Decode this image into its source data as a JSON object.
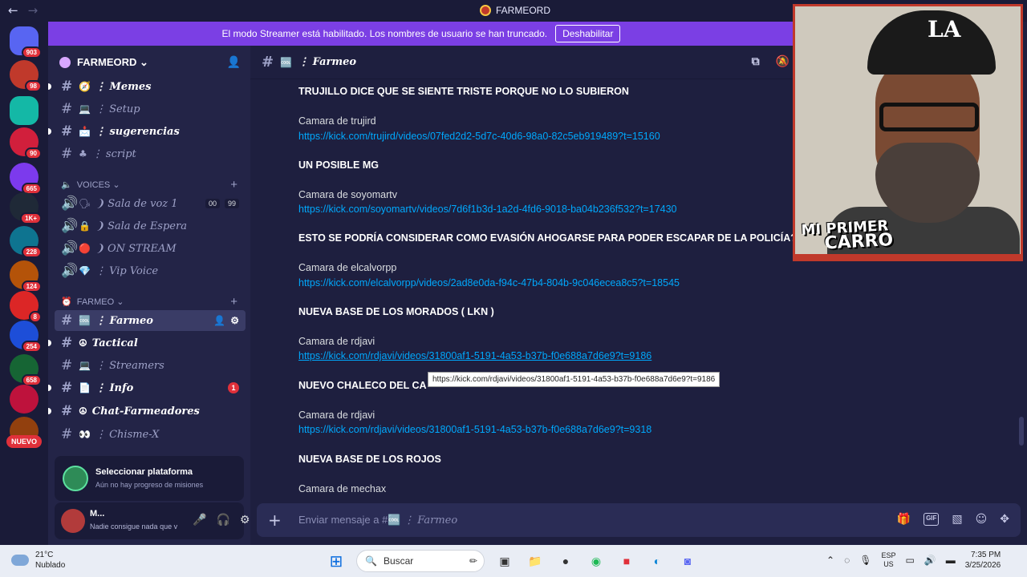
{
  "titlebar": {
    "back_icon": "←",
    "forward_icon": "→",
    "app_title": "FARMEORD"
  },
  "banner": {
    "text": "El modo Streamer está habilitado. Los nombres de usuario se han truncado.",
    "button": "Deshabilitar",
    "color": "#7b3fe4"
  },
  "servers": [
    {
      "name": "home",
      "badge": "903",
      "color": "#5865f2"
    },
    {
      "name": "farmeo-server",
      "badge": "98",
      "color": "#c0392b"
    },
    {
      "name": "folder",
      "badge": "",
      "color": "#14b8a6"
    },
    {
      "name": "server-red",
      "badge": "90",
      "color": "#d11f3c"
    },
    {
      "name": "server-purple",
      "badge": "665",
      "color": "#7c3aed"
    },
    {
      "name": "server-speaker",
      "badge": "1K+",
      "color": "#1f2937"
    },
    {
      "name": "server-girl",
      "badge": "228",
      "color": "#0e7490"
    },
    {
      "name": "server-anime",
      "badge": "124",
      "color": "#b45309"
    },
    {
      "name": "server-mushroom",
      "badge": "8",
      "color": "#dc2626"
    },
    {
      "name": "server-sonic",
      "badge": "254",
      "color": "#1d4ed8"
    },
    {
      "name": "server-green",
      "badge": "658",
      "color": "#166534"
    },
    {
      "name": "server-char",
      "badge": "",
      "color": "#be123c"
    },
    {
      "name": "server-last",
      "badge": "",
      "color": "#92400e"
    }
  ],
  "new_label": "NUEVO",
  "guild": {
    "name": "FARMEORD ⌄"
  },
  "channels": {
    "memes": {
      "emoji": "🧭",
      "label": "⋮ Memes"
    },
    "setup": {
      "emoji": "💻",
      "label": "⋮ Setup"
    },
    "sugerencias": {
      "emoji": "📩",
      "label": "⋮ sugerencias"
    },
    "script": {
      "emoji": "♣",
      "label": "⋮ script"
    },
    "voices_category": "VOICES ⌄",
    "sala_voz": {
      "emoji": "🗣",
      "label": "❩ Sala de voz 1",
      "count1": "00",
      "count2": "99"
    },
    "sala_espera": {
      "emoji": "🔒",
      "label": "❩ Sala de Espera"
    },
    "on_stream": {
      "emoji": "🔴",
      "label": "❩ ON STREAM"
    },
    "vip_voice": {
      "emoji": "💎",
      "label": "⋮ Vip Voice"
    },
    "farmeo_category": "FARMEO ⌄",
    "farmeo": {
      "emoji": "🆒",
      "label": "⋮ Farmeo"
    },
    "tactical": {
      "emoji": "☮",
      "label": "Tactical"
    },
    "streamers": {
      "emoji": "💻",
      "label": "⋮ Streamers"
    },
    "info": {
      "emoji": "📄",
      "label": "⋮ Info",
      "mentions": "1"
    },
    "chat_farmeadores": {
      "emoji": "☮",
      "label": "Chat-Farmeadores"
    },
    "chisme": {
      "emoji": "👀",
      "label": "⋮ Chisme-X"
    }
  },
  "quest": {
    "title": "Seleccionar plataforma",
    "subtitle": "Aún no hay progreso de misiones"
  },
  "user": {
    "name": "M...",
    "status": "Nadie consigue nada que v"
  },
  "chat": {
    "channel_name": "⋮ Farmeo",
    "channel_emoji": "🆒",
    "composer_placeholder_prefix": "Enviar mensaje a #🆒",
    "composer_placeholder_channel": "⋮ Farmeo"
  },
  "messages": [
    {
      "title": "TRUJILLO DICE QUE SE SIENTE TRISTE PORQUE NO LO SUBIERON",
      "camera": "Camara de trujird",
      "link": "https://kick.com/trujird/videos/07fed2d2-5d7c-40d6-98a0-82c5eb919489?t=15160"
    },
    {
      "title": "UN POSIBLE MG",
      "camera": "Camara de soyomartv",
      "link": "https://kick.com/soyomartv/videos/7d6f1b3d-1a2d-4fd6-9018-ba04b236f532?t=17430"
    },
    {
      "title": "ESTO SE PODRÍA CONSIDERAR COMO EVASIÓN AHOGARSE PARA PODER ESCAPAR DE LA POLICÍA?",
      "camera": "Camara de elcalvorpp",
      "link": "https://kick.com/elcalvorpp/videos/2ad8e0da-f94c-47b4-804b-9c046ecea8c5?t=18545"
    },
    {
      "title": "NUEVA BASE DE LOS MORADOS ( LKN )",
      "camera": "Camara de rdjavi",
      "link": "https://kick.com/rdjavi/videos/31800af1-5191-4a53-b37b-f0e688a7d6e9?t=9186"
    },
    {
      "title": "NUEVO CHALECO DEL CA",
      "camera": "Camara de rdjavi",
      "link": "https://kick.com/rdjavi/videos/31800af1-5191-4a53-b37b-f0e688a7d6e9?t=9318"
    },
    {
      "title": "NUEVA BASE DE LOS ROJOS",
      "camera": "Camara de mechax",
      "link": ""
    }
  ],
  "tooltip": "https://kick.com/rdjavi/videos/31800af1-5191-4a53-b37b-f0e688a7d6e9?t=9186",
  "webcam": {
    "overlay_line1": "MI PRIMER",
    "overlay_line2": "CARRO"
  },
  "taskbar": {
    "temp": "21°C",
    "weather": "Nublado",
    "search": "Buscar",
    "lang1": "ESP",
    "lang2": "US",
    "time": "7:35 PM",
    "date": "3/25/2026"
  }
}
